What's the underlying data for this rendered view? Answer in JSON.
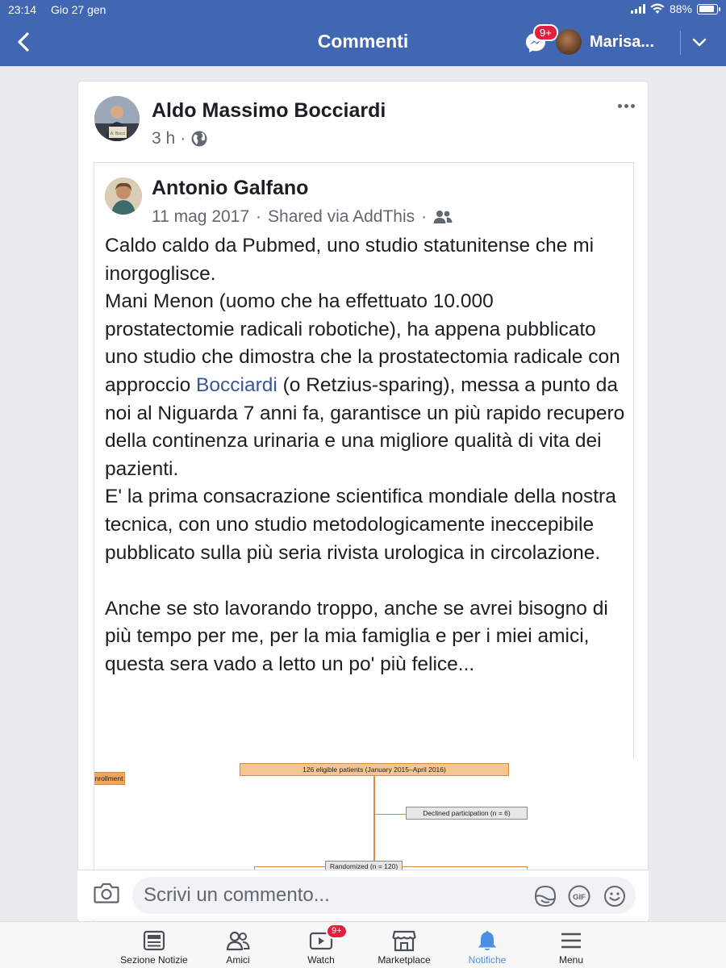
{
  "status_bar": {
    "time": "23:14",
    "date": "Gio 27 gen",
    "battery": "88%",
    "battery_level": 0.88
  },
  "nav": {
    "title": "Commenti",
    "messenger_badge": "9+",
    "user_name": "Marisa..."
  },
  "post": {
    "author": "Aldo Massimo Bocciardi",
    "time": "3 h",
    "separator": "·",
    "avatar_caption": "A. Bocci",
    "shared": {
      "author": "Antonio Galfano",
      "date": "11 mag 2017",
      "via": "Shared via AddThis",
      "separator": "·",
      "text": {
        "p1": "Caldo caldo da Pubmed, uno studio statunitense che mi inorgoglisce.",
        "p2": "Mani Menon (uomo che ha effettuato 10.000 prostatectomie radicali robotiche), ha appena pubblicato uno studio che dimostra che la prostatectomia radicale con approccio ",
        "p2_link": "Bocciardi",
        "p2_after": " (o Retzius-sparing), messa a punto da noi al Niguarda 7 anni fa, garantisce un più rapido recupero della continenza urinaria e una migliore qualità di vita dei pazienti.",
        "p3": "E' la prima consacrazione scientifica mondiale della nostra tecnica, con uno studio metodologicamente ineccepibile pubblicato sulla più seria rivista urologica in circolazione.",
        "p4": "Anche se sto lavorando troppo, anche se avrei bisogno di più tempo per me, per la mia famiglia e per i miei amici, questa sera vado a letto un po' più felice..."
      },
      "figure": {
        "enrollment": "nrollment",
        "eligible": "126 eligible patients (January 2015–April 2016)",
        "declined": "Declined participation (n = 6)",
        "randomized": "Randomized (n = 120)"
      }
    }
  },
  "comment_bar": {
    "placeholder": "Scrivi un commento...",
    "gif_label": "GIF"
  },
  "tabs": [
    {
      "label": "Sezione Notizie",
      "icon": "news-feed-icon"
    },
    {
      "label": "Amici",
      "icon": "friends-icon"
    },
    {
      "label": "Watch",
      "icon": "watch-icon",
      "badge": "9+"
    },
    {
      "label": "Marketplace",
      "icon": "marketplace-icon"
    },
    {
      "label": "Notifiche",
      "icon": "bell-icon",
      "active": true
    },
    {
      "label": "Menu",
      "icon": "menu-icon"
    }
  ],
  "colors": {
    "brand": "#4267b2",
    "active_tab": "#4a90e2",
    "link": "#385898",
    "badge": "#e41e3f"
  }
}
